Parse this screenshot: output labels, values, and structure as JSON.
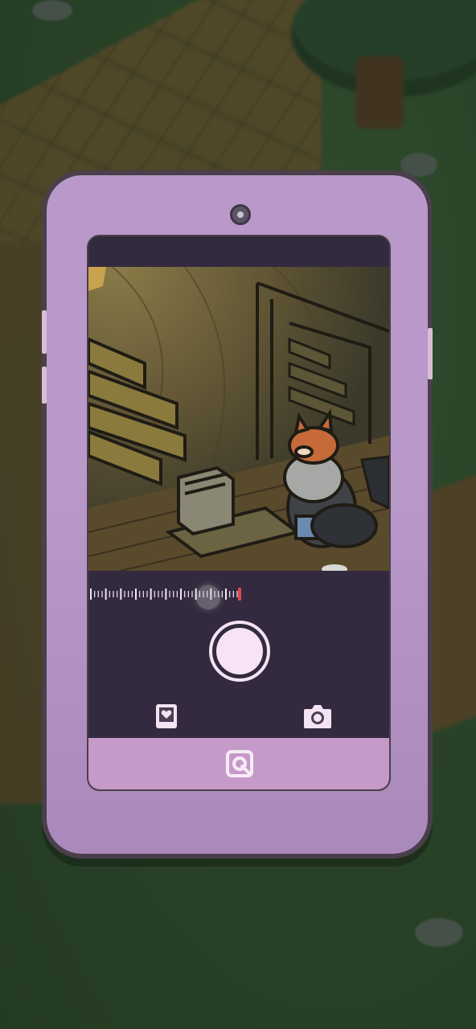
{
  "scene": {
    "title": "",
    "phone_app": "camera"
  },
  "colors": {
    "phone_body": "#b999c9",
    "phone_outline": "#4a3f4a",
    "screen_bg": "#332a3f",
    "bottom_bar": "#c69ac8",
    "shutter": "#f6e3f6",
    "zoom_end_marker": "#e0474c"
  },
  "camera": {
    "zoom_level": 0.8,
    "zoom_tick_count": 40,
    "controls": {
      "shutter_icon": "shutter-button",
      "album_icon": "photo-album-heart-icon",
      "switch_icon": "camera-icon",
      "home_icon": "home-square-icon"
    }
  },
  "viewfinder": {
    "subject": "fox-and-raccoon-characters",
    "props": [
      "wooden-stairs",
      "doorway-frame",
      "cash-register",
      "wooden-counter"
    ]
  }
}
